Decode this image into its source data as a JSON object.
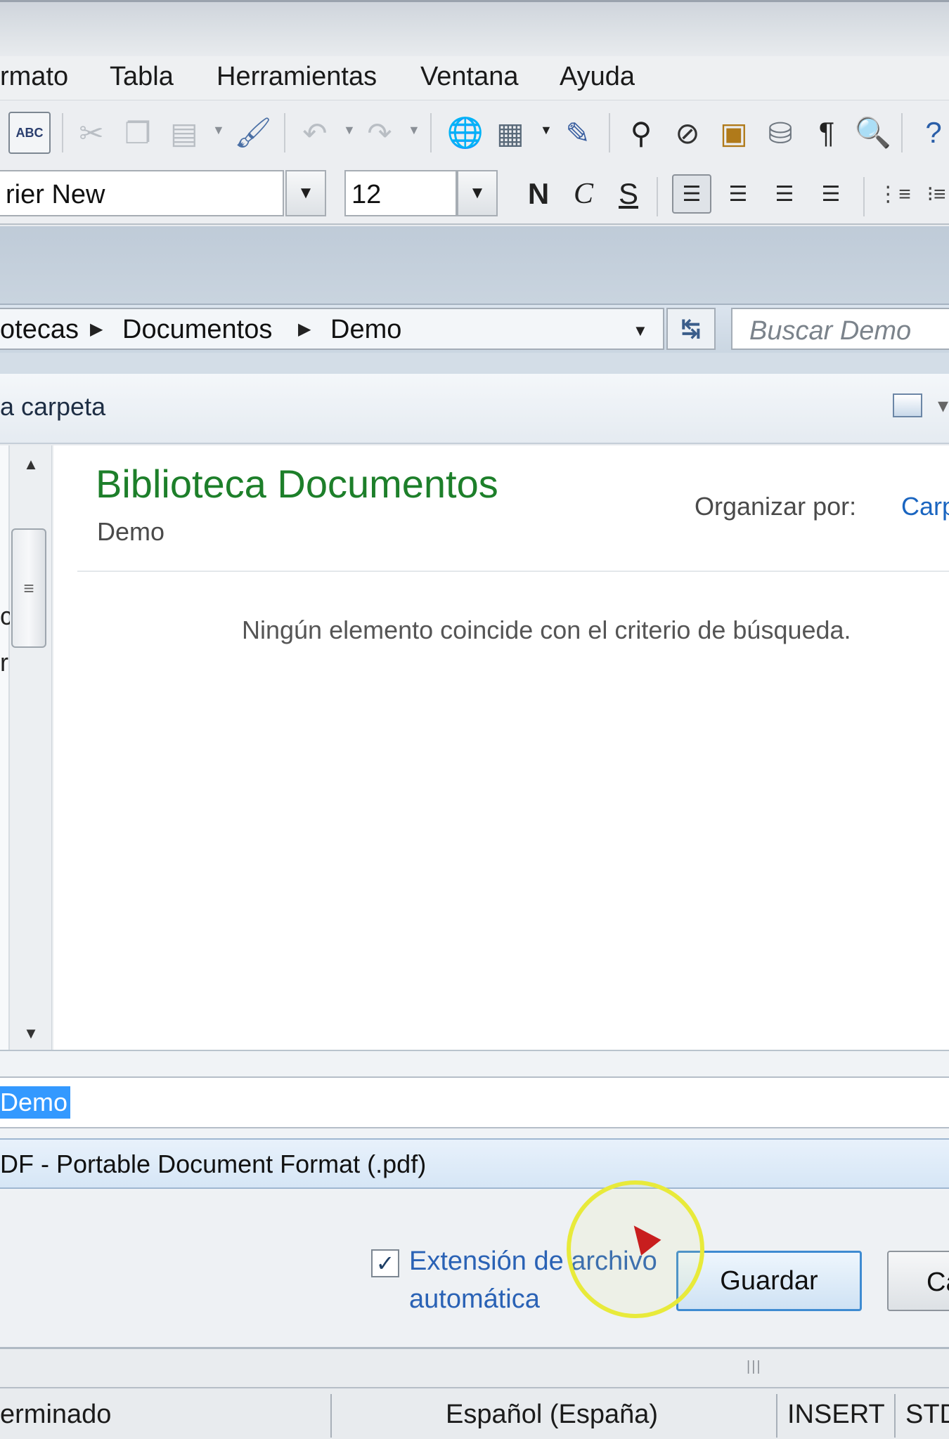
{
  "menu": {
    "items": [
      "rmato",
      "Tabla",
      "Herramientas",
      "Ventana",
      "Ayuda"
    ]
  },
  "toolbar": {
    "icons": [
      "spellcheck-icon",
      "cut-icon",
      "copy-icon",
      "paste-icon",
      "clone-formatting-icon",
      "undo-icon",
      "redo-icon",
      "hyperlink-icon",
      "table-icon",
      "draw-functions-icon",
      "find-replace-icon",
      "navigator-icon",
      "gallery-icon",
      "data-sources-icon",
      "formatting-marks-icon",
      "zoom-icon",
      "help-icon"
    ]
  },
  "format": {
    "font_name": "rier New",
    "font_size": "12",
    "bold_label": "N",
    "italic_label": "C",
    "underline_label": "S"
  },
  "dialog": {
    "breadcrumbs": [
      "otecas",
      "Documentos",
      "Demo"
    ],
    "search_placeholder": "Buscar Demo",
    "new_folder_label": "a carpeta",
    "library_title": "Biblioteca Documentos",
    "library_subtitle": "Demo",
    "organize_label": "Organizar por:",
    "organize_value": "Carp",
    "empty_message": "Ningún elemento coincide con el criterio de búsqueda.",
    "file_name": "Demo",
    "file_type": "DF - Portable Document Format (.pdf)",
    "auto_extension_checked": true,
    "auto_extension_label": "Extensión de archivo automática",
    "save_label": "Guardar",
    "cancel_label": "Ca"
  },
  "status": {
    "state": "erminado",
    "language": "Español (España)",
    "mode": "INSERT",
    "selection": "STD"
  },
  "colors": {
    "library_title": "#1d7f2a",
    "link": "#2a62b5",
    "selection": "#3399ff",
    "highlight_ring": "#e8ea3a",
    "cursor": "#c81e1e"
  }
}
